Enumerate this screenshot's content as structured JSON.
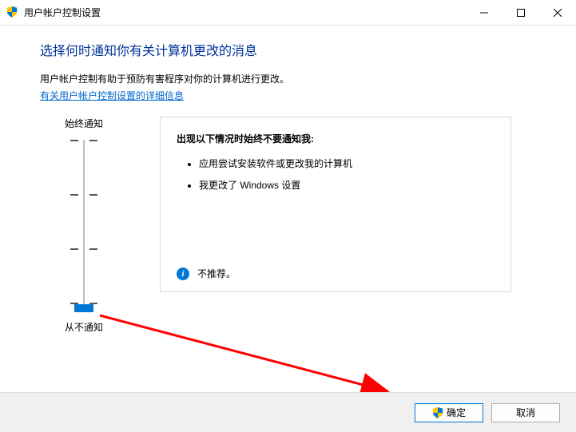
{
  "window": {
    "title": "用户帐户控制设置"
  },
  "heading": "选择何时通知你有关计算机更改的消息",
  "description": "用户帐户控制有助于预防有害程序对你的计算机进行更改。",
  "link": "有关用户帐户控制设置的详细信息",
  "slider": {
    "top_label": "始终通知",
    "bottom_label": "从不通知"
  },
  "info": {
    "title": "出现以下情况时始终不要通知我:",
    "items": [
      "应用尝试安装软件或更改我的计算机",
      "我更改了 Windows 设置"
    ],
    "footer_text": "不推荐。"
  },
  "buttons": {
    "ok": "确定",
    "cancel": "取消"
  }
}
